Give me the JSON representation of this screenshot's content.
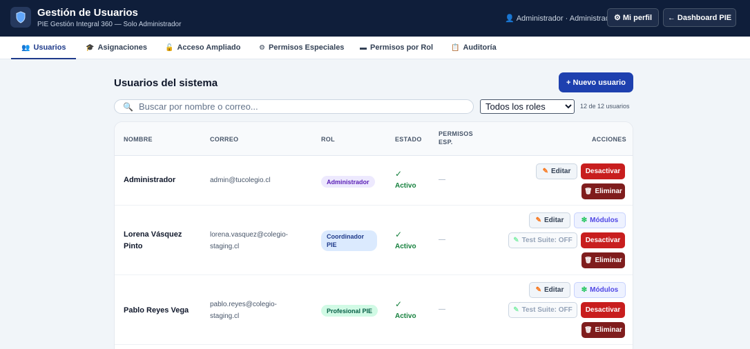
{
  "header": {
    "title": "Gestión de Usuarios",
    "subtitle": "PIE Gestión Integral 360 — Solo Administrador",
    "user_info": "Administrador · Administrador",
    "profile_button": "⚙ Mi perfil",
    "dashboard_button": "← Dashboard PIE"
  },
  "tabs": [
    {
      "label": "Usuarios",
      "icon": "users-icon",
      "active": true
    },
    {
      "label": "Asignaciones",
      "icon": "graduation-cap-icon"
    },
    {
      "label": "Acceso Ampliado",
      "icon": "lock-icon"
    },
    {
      "label": "Permisos Especiales",
      "icon": "gear-icon"
    },
    {
      "label": "Permisos por Rol",
      "icon": "folder-icon"
    },
    {
      "label": "Auditoría",
      "icon": "clipboard-icon"
    }
  ],
  "main": {
    "title": "Usuarios del sistema",
    "new_user_button": "+ Nuevo usuario",
    "search_placeholder": "Buscar por nombre o correo...",
    "role_filter_selected": "Todos los roles",
    "user_count": "12 de 12 usuarios"
  },
  "table": {
    "headers": {
      "name": "NOMBRE",
      "email": "CORREO",
      "role": "ROL",
      "status": "ESTADO",
      "permissions": "PERMISOS ESP.",
      "actions": "ACCIONES"
    },
    "rows": [
      {
        "name": "Administrador",
        "email": "admin@tucolegio.cl",
        "role": "Administrador",
        "status": "Activo",
        "check": "✓",
        "permissions": "—"
      },
      {
        "name": "Lorena Vásquez Pinto",
        "email": "lorena.vasquez@colegio-staging.cl",
        "role": "Coordinador PIE",
        "status": "Activo",
        "check": "✓",
        "permissions": "—"
      },
      {
        "name": "Pablo Reyes Vega",
        "email": "pablo.reyes@colegio-staging.cl",
        "role": "Profesional PIE",
        "status": "Activo",
        "check": "✓",
        "permissions": "—"
      }
    ]
  },
  "actions": {
    "edit": "Editar",
    "modules": "Módulos",
    "test_suite": "Test Suite: OFF",
    "deactivate": "Desactivar",
    "delete": "Eliminar"
  },
  "colors": {
    "header_bg": "#0f1e3a",
    "primary": "#1e40af",
    "danger": "#c81e1e",
    "danger_dark": "#7f1d1d",
    "success": "#15803d"
  }
}
